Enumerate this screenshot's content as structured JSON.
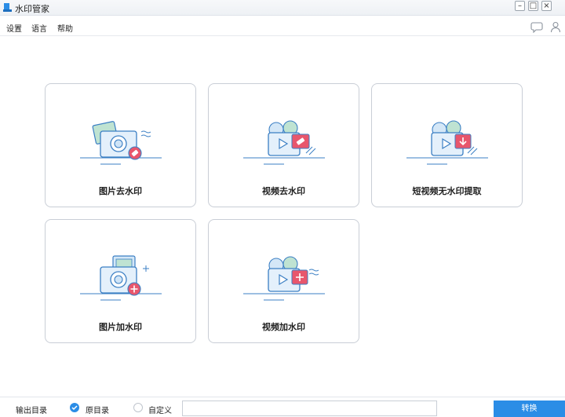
{
  "window": {
    "title": "水印管家"
  },
  "menu": {
    "settings": "设置",
    "language": "语言",
    "help": "帮助"
  },
  "cards": [
    {
      "label": "图片去水印"
    },
    {
      "label": "视频去水印"
    },
    {
      "label": "短视频无水印提取"
    },
    {
      "label": "图片加水印"
    },
    {
      "label": "视频加水印"
    }
  ],
  "bottom": {
    "output_dir_label": "输出目录",
    "option_original": "原目录",
    "option_custom": "自定义",
    "convert_label": "转换"
  },
  "colors": {
    "accent": "#2b8de6",
    "icon_red": "#e8566c",
    "icon_line": "#3b7fc4"
  }
}
